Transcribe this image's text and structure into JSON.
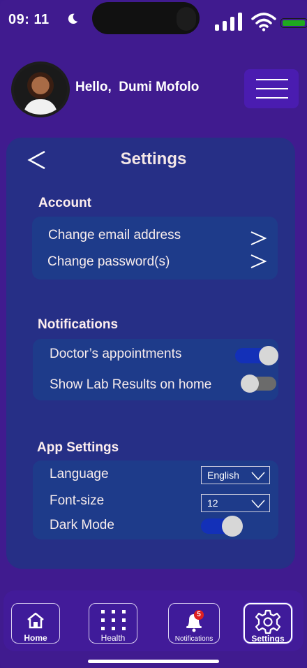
{
  "status_bar": {
    "time": "09: 11"
  },
  "header": {
    "greeting": "Hello,  Dumi Mofolo"
  },
  "settings": {
    "title": "Settings",
    "account": {
      "title": "Account",
      "items": [
        {
          "label": "Change email address"
        },
        {
          "label": "Change password(s)"
        }
      ]
    },
    "notifications": {
      "title": "Notifications",
      "items": [
        {
          "label": "Doctor’s appointments",
          "enabled": true
        },
        {
          "label": "Show Lab Results on home",
          "enabled": false
        }
      ]
    },
    "app_settings": {
      "title": "App Settings",
      "language_label": "Language",
      "language_value": "English",
      "font_size_label": "Font-size",
      "font_size_value": "12",
      "dark_mode_label": "Dark Mode",
      "dark_mode_enabled": true
    }
  },
  "bottom_nav": {
    "items": [
      {
        "label": "Home",
        "icon": "home-icon"
      },
      {
        "label": "Health",
        "icon": "grid-icon"
      },
      {
        "label": "Notifications",
        "icon": "bell-icon",
        "badge": "5"
      },
      {
        "label": "Settings",
        "icon": "gear-icon",
        "active": true
      }
    ]
  },
  "colors": {
    "background": "#401b8f",
    "card": "#262f86",
    "group": "#1e3b8a",
    "toggle_on": "#1330b8",
    "badge": "#e02020"
  }
}
